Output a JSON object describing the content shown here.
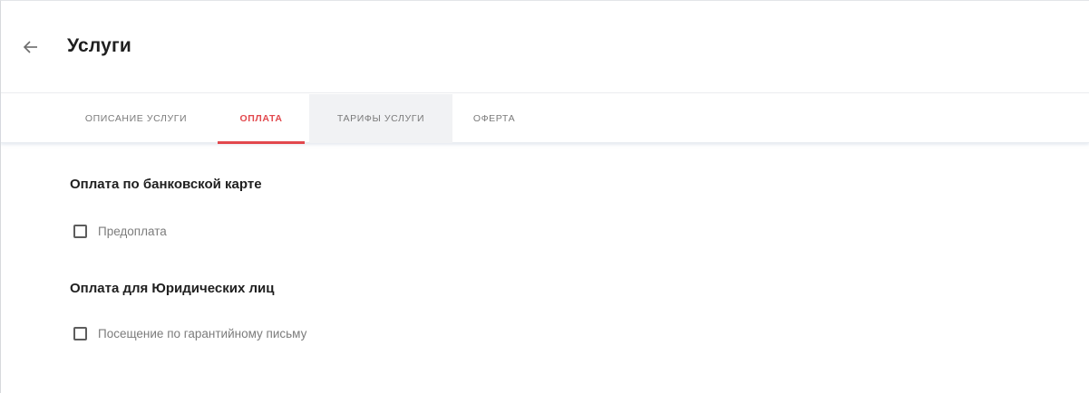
{
  "header": {
    "back_icon": "arrow-left-icon",
    "title": "Услуги"
  },
  "tabs": [
    {
      "label": "ОПИСАНИЕ УСЛУГИ",
      "active": false
    },
    {
      "label": "ОПЛАТА",
      "active": true
    },
    {
      "label": "ТАРИФЫ УСЛУГИ",
      "active": false
    },
    {
      "label": "ОФЕРТА",
      "active": false
    }
  ],
  "sections": [
    {
      "title": "Оплата по банковской карте",
      "options": [
        {
          "label": "Предоплата",
          "checked": false
        }
      ]
    },
    {
      "title": "Оплата для Юридических лиц",
      "options": [
        {
          "label": "Посещение по гарантийному письму",
          "checked": false
        }
      ]
    }
  ],
  "colors": {
    "accent": "#e2484d",
    "tab_text": "#7a7a7a",
    "label_text": "#7c7c7c"
  }
}
